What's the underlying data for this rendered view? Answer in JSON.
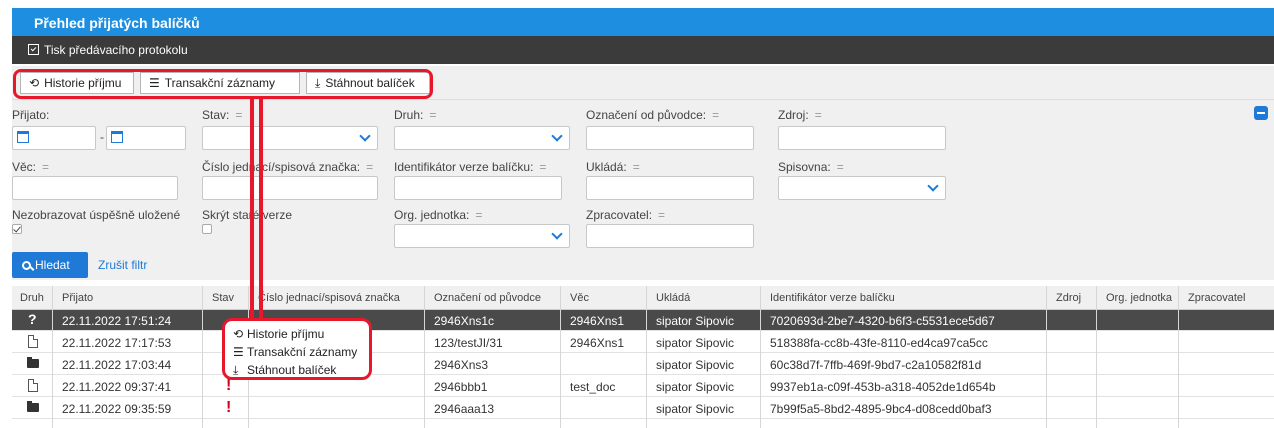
{
  "header": {
    "title": "Přehled přijatých balíčků"
  },
  "actionbar": {
    "print_label": "Tisk předávacího protokolu"
  },
  "toolbar": {
    "history_label": "Historie příjmu",
    "transactions_label": "Transakční záznamy",
    "download_label": "Stáhnout balíček"
  },
  "filters": {
    "prijato": "Přijato:",
    "stav": "Stav:",
    "druh": "Druh:",
    "oznaceni": "Označení od původce:",
    "zdroj": "Zdroj:",
    "vec": "Věc:",
    "cislo": "Číslo jednací/spisová značka:",
    "identifikator": "Identifikátor verze balíčku:",
    "uklada": "Ukládá:",
    "spisovna": "Spisovna:",
    "nezobrazovat": "Nezobrazovat úspěšně uložené",
    "skryt": "Skrýt staré verze",
    "org": "Org. jednotka:",
    "zpracovatel": "Zpracovatel:",
    "eq": "=",
    "date_sep": "-",
    "nezobrazovat_checked": true,
    "skryt_checked": false
  },
  "buttons": {
    "search": "Hledat",
    "clear": "Zrušit filtr"
  },
  "table": {
    "columns": [
      "Druh",
      "Přijato",
      "Stav",
      "Číslo jednací/spisová značka",
      "Označení od původce",
      "Věc",
      "Ukládá",
      "Identifikátor verze balíčku",
      "Zdroj",
      "Org. jednotka",
      "Zpracovatel"
    ],
    "rows": [
      {
        "druh": "?",
        "prijato": "22.11.2022 17:51:24",
        "stav": "",
        "cislo": "",
        "oznaceni": "2946Xns1c",
        "vec": "2946Xns1",
        "uklada": "sipator Sipovic",
        "identifikator": "7020693d-2be7-4320-b6f3-c5531ece5d67",
        "selected": true
      },
      {
        "druh": "document",
        "prijato": "22.11.2022 17:17:53",
        "stav": "!",
        "cislo": "",
        "oznaceni": "123/testJI/31",
        "vec": "2946Xns1",
        "uklada": "sipator Sipovic",
        "identifikator": "518388fa-cc8b-43fe-8110-ed4ca97ca5cc",
        "selected": false
      },
      {
        "druh": "folder",
        "prijato": "22.11.2022 17:03:44",
        "stav": "!",
        "cislo": "",
        "oznaceni": "2946Xns3",
        "vec": "",
        "uklada": "sipator Sipovic",
        "identifikator": "60c38d7f-7ffb-469f-9bd7-c2a10582f81d",
        "selected": false
      },
      {
        "druh": "document",
        "prijato": "22.11.2022 09:37:41",
        "stav": "!",
        "cislo": "",
        "oznaceni": "2946bbb1",
        "vec": "test_doc",
        "uklada": "sipator Sipovic",
        "identifikator": "9937eb1a-c09f-453b-a318-4052de1d654b",
        "selected": false
      },
      {
        "druh": "folder",
        "prijato": "22.11.2022 09:35:59",
        "stav": "!",
        "cislo": "",
        "oznaceni": "2946aaa13",
        "vec": "",
        "uklada": "sipator Sipovic",
        "identifikator": "7b99f5a5-8bd2-4895-9bc4-d08cedd0baf3",
        "selected": false
      }
    ]
  },
  "context_menu": {
    "history": "Historie příjmu",
    "transactions": "Transakční záznamy",
    "download": "Stáhnout balíček"
  },
  "icons": {
    "history": "history-icon",
    "list": "list-icon",
    "download": "download-icon",
    "print": "print-checklist-icon",
    "calendar": "calendar-icon",
    "search": "search-icon"
  },
  "colors": {
    "header_blue": "#1e8fe0",
    "dark_bar": "#3b3b3b",
    "accent_blue": "#1e7ad6",
    "annotation_red": "#e8182c",
    "error_red": "#d0021b",
    "selected_row": "#4a4a4a"
  }
}
